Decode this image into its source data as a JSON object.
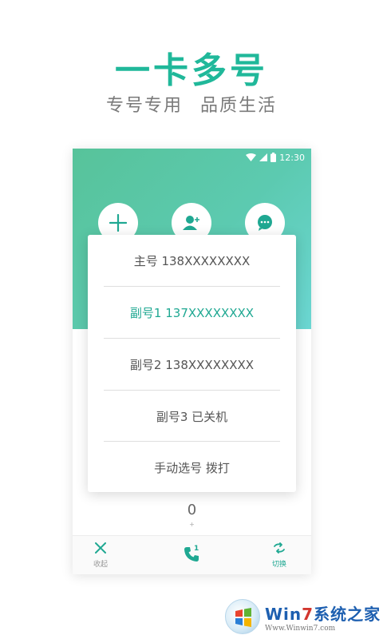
{
  "promo": {
    "headline": "一卡多号",
    "subtitle_left": "专号专用",
    "subtitle_right": "品质生活"
  },
  "status_bar": {
    "time": "12:30",
    "icons": [
      "wifi-icon",
      "signal-icon",
      "battery-icon"
    ]
  },
  "header_actions": [
    {
      "icon": "plus-icon"
    },
    {
      "icon": "add-contact-icon"
    },
    {
      "icon": "message-icon"
    }
  ],
  "sim_menu": {
    "items": [
      {
        "label": "主号 138XXXXXXXX",
        "active": false
      },
      {
        "label": "副号1 137XXXXXXXX",
        "active": true
      },
      {
        "label": "副号2 138XXXXXXXX",
        "active": false
      },
      {
        "label": "副号3 已关机",
        "active": false
      },
      {
        "label": "手动选号 拨打",
        "active": false
      }
    ]
  },
  "dialer": {
    "digit": "0",
    "sub": "+"
  },
  "bottom_bar": {
    "collapse_label": "收起",
    "call_badge": "1",
    "switch_label": "切换"
  },
  "watermark": {
    "title_a": "Win",
    "title_b": "7",
    "title_c": "系统之家",
    "url": "Www.Winwin7.com"
  },
  "colors": {
    "accent": "#20b89a",
    "header_gradient_start": "#57c39a",
    "header_gradient_end": "#6bd6d2"
  }
}
